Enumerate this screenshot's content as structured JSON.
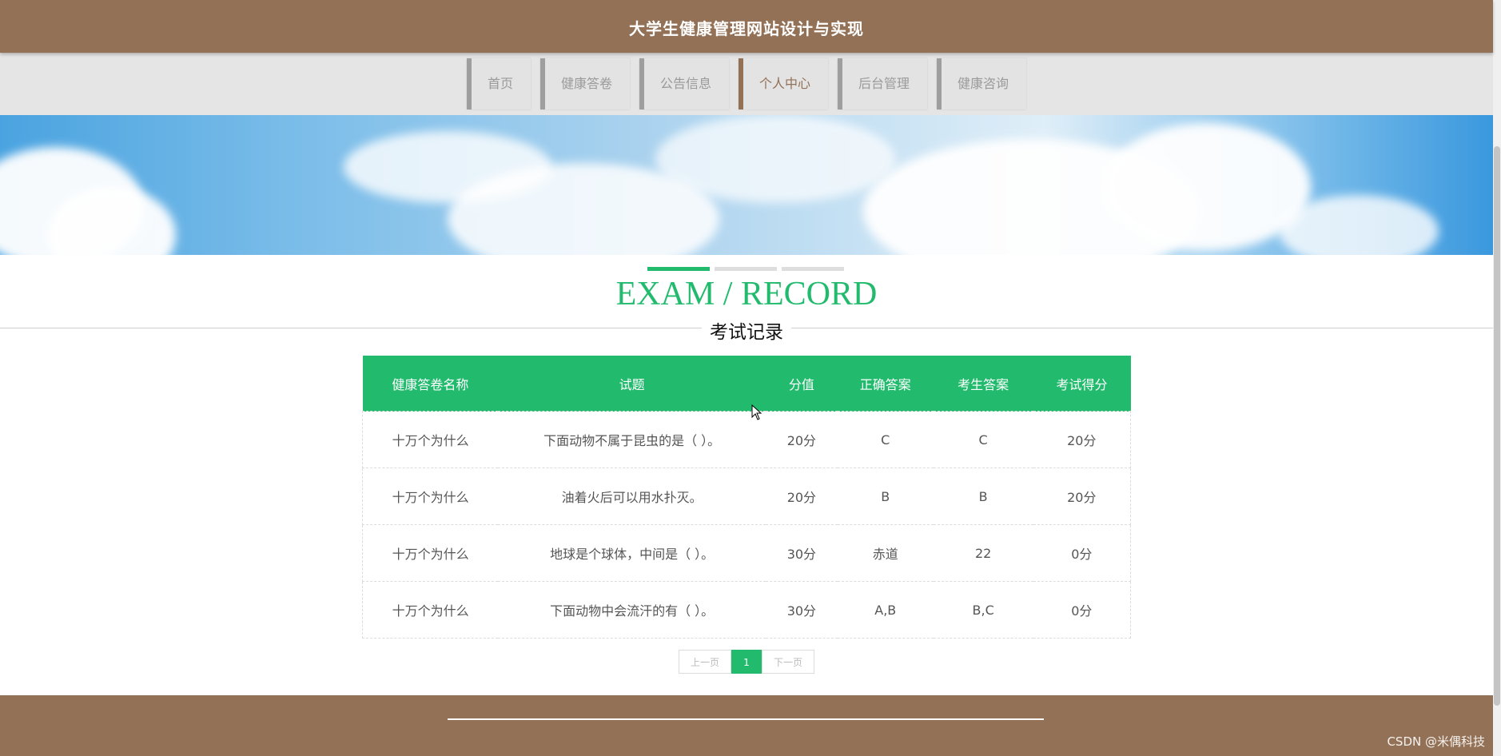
{
  "header": {
    "title": "大学生健康管理网站设计与实现"
  },
  "nav": {
    "items": [
      {
        "label": "首页"
      },
      {
        "label": "健康答卷"
      },
      {
        "label": "公告信息"
      },
      {
        "label": "个人中心",
        "active": true
      },
      {
        "label": "后台管理"
      },
      {
        "label": "健康咨询"
      }
    ]
  },
  "section": {
    "title_en": "EXAM / RECORD",
    "title_cn": "考试记录"
  },
  "table": {
    "headers": [
      "健康答卷名称",
      "试题",
      "分值",
      "正确答案",
      "考生答案",
      "考试得分"
    ],
    "rows": [
      [
        "十万个为什么",
        "下面动物不属于昆虫的是（ ）。",
        "20分",
        "C",
        "C",
        "20分"
      ],
      [
        "十万个为什么",
        "油着火后可以用水扑灭。",
        "20分",
        "B",
        "B",
        "20分"
      ],
      [
        "十万个为什么",
        "地球是个球体，中间是（   ）。",
        "30分",
        "赤道",
        "22",
        "0分"
      ],
      [
        "十万个为什么",
        "下面动物中会流汗的有（   ）。",
        "30分",
        "A,B",
        "B,C",
        "0分"
      ]
    ]
  },
  "pager": {
    "prev": "上一页",
    "current": "1",
    "next": "下一页"
  },
  "watermark": "CSDN @米偶科技",
  "colors": {
    "brand_brown": "#937156",
    "accent_green": "#22bb6e"
  }
}
